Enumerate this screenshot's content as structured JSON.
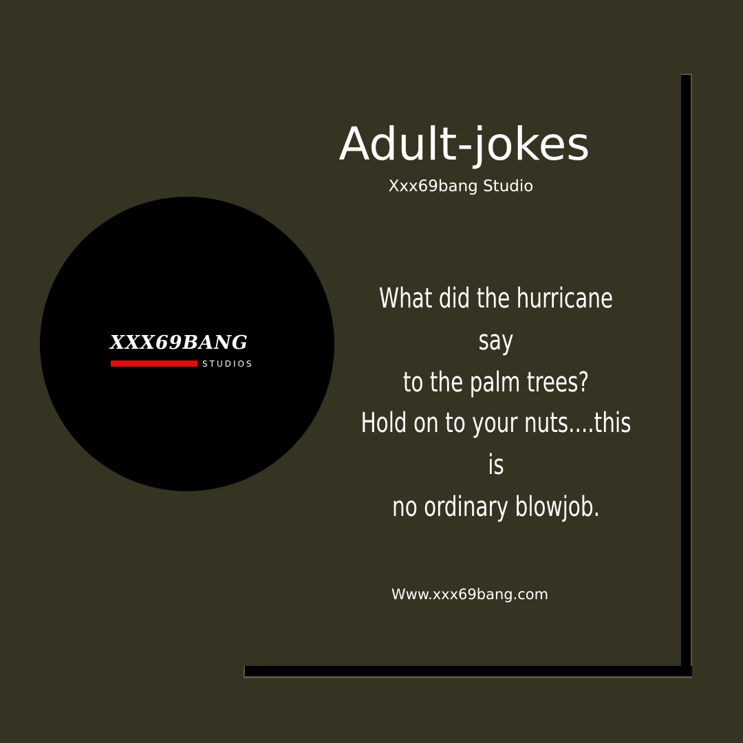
{
  "header": {
    "title": "Adult-jokes",
    "subtitle": "Xxx69bang Studio"
  },
  "logo": {
    "wordmark": "XXX69BANG",
    "tagline": "STUDIOS",
    "accent_color": "#e10d0d"
  },
  "joke": {
    "question_line1": "What did the hurricane say",
    "question_line2": "to the palm trees?",
    "answer_line1": "Hold on to your nuts....this is",
    "answer_line2": "no ordinary blowjob."
  },
  "footer": {
    "website": "Www.xxx69bang.com"
  },
  "colors": {
    "background": "#353321",
    "frame": "#000000",
    "text": "#ffffff"
  }
}
